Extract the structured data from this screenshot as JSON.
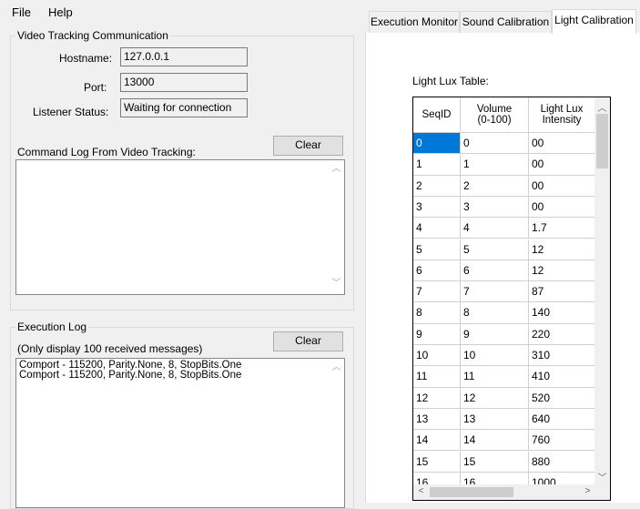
{
  "menu": {
    "file": "File",
    "help": "Help"
  },
  "video_group": {
    "title": "Video Tracking Communication",
    "hostname_label": "Hostname:",
    "hostname_value": "127.0.0.1",
    "port_label": "Port:",
    "port_value": "13000",
    "status_label": "Listener Status:",
    "status_value": "Waiting for connection",
    "cmdlog_label": "Command Log From Video Tracking:",
    "clear_label": "Clear"
  },
  "exec_group": {
    "title": "Execution Log",
    "subtitle": "(Only display 100 received messages)",
    "clear_label": "Clear",
    "lines": [
      "Comport - 115200, Parity.None, 8, StopBits.One",
      "Comport - 115200, Parity.None, 8, StopBits.One"
    ]
  },
  "tabs": [
    "Execution Monitor",
    "Sound Calibration",
    "Light Calibration"
  ],
  "active_tab": "Light Calibration",
  "lux_table": {
    "title": "Light Lux Table:",
    "headers": [
      "SeqID",
      "Volume\n(0-100)",
      "Light Lux\nIntensity"
    ],
    "rows": [
      [
        "0",
        "0",
        "00"
      ],
      [
        "1",
        "1",
        "00"
      ],
      [
        "2",
        "2",
        "00"
      ],
      [
        "3",
        "3",
        "00"
      ],
      [
        "4",
        "4",
        "1.7"
      ],
      [
        "5",
        "5",
        "12"
      ],
      [
        "6",
        "6",
        "12"
      ],
      [
        "7",
        "7",
        "87"
      ],
      [
        "8",
        "8",
        "140"
      ],
      [
        "9",
        "9",
        "220"
      ],
      [
        "10",
        "10",
        "310"
      ],
      [
        "11",
        "11",
        "410"
      ],
      [
        "12",
        "12",
        "520"
      ],
      [
        "13",
        "13",
        "640"
      ],
      [
        "14",
        "14",
        "760"
      ],
      [
        "15",
        "15",
        "880"
      ],
      [
        "16",
        "16",
        "1000"
      ]
    ]
  },
  "colors": {
    "selection": "#0078d7"
  }
}
